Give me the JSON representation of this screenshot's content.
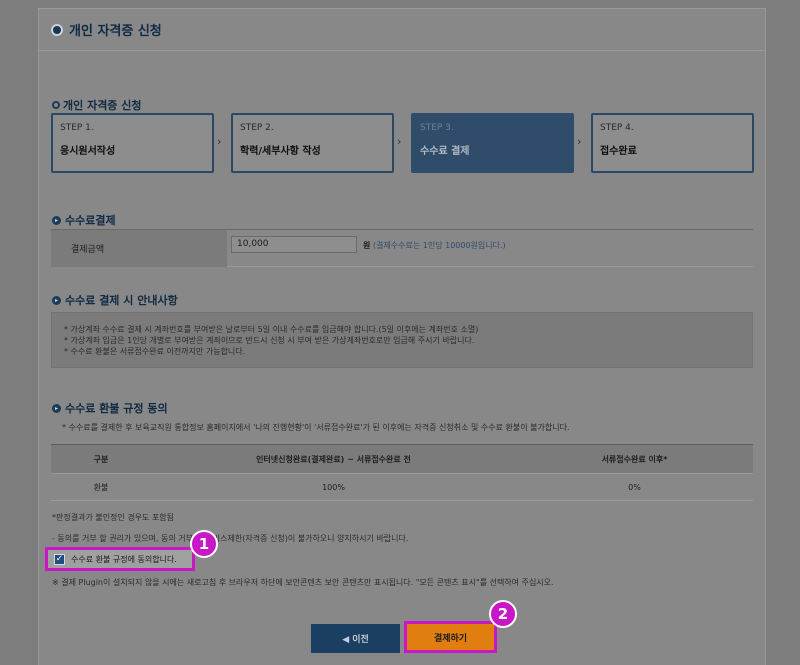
{
  "header": {
    "title": "개인 자격증 신청"
  },
  "section_title": "개인 자격증 신청",
  "steps": [
    {
      "num": "STEP 1.",
      "name": "응시원서작성"
    },
    {
      "num": "STEP 2.",
      "name": "학력/세부사항 작성"
    },
    {
      "num": "STEP 3.",
      "name": "수수료 결제"
    },
    {
      "num": "STEP 4.",
      "name": "접수완료"
    }
  ],
  "active_step": 3,
  "payment": {
    "title": "수수료결제",
    "label": "결제금액",
    "amount": "10,000",
    "unit": "원",
    "unit_note": "(결제수수료는 1인당 10000원입니다.)"
  },
  "notice": {
    "title": "수수료 결제 시 안내사항",
    "lines": [
      "* 가상계좌 수수료 결제 시 계좌번호를 부여받은 날로부터 5일 이내 수수료를 입금해야 합니다.(5일 이후에는 계좌번호 소멸)",
      "* 가상계좌 입금은 1인당 개별로 부여받은 계좌이므로 반드시 신청 시 부여 받은 가상계좌번호로만 입금해 주시기 바랍니다.",
      "* 수수료 환불은 서류접수완료 이전까지만 가능합니다."
    ]
  },
  "refund": {
    "title": "수수료 환불 규정 동의",
    "desc": "* 수수료를 결제한 후 보육교직원 통합정보 홈페이지에서 '나의 진행현황'이 '서류접수완료'가 된 이후에는 자격증 신청취소 및 수수료 환불이 불가합니다.",
    "table": {
      "headers": [
        "구분",
        "인터넷신청완료(결제완료) ~ 서류접수완료 전",
        "서류접수완료 이후*"
      ],
      "rows": [
        [
          "환불",
          "100%",
          "0%"
        ]
      ]
    }
  },
  "notes": {
    "review": "*판정결과가 불인정인 경우도 포함됨",
    "consent": "- 동의를 거부 할 권리가 있으며, 동의 거부 시 서비스제한(자격증 신청)이 불가하오니 양지하시기 바랍니다.",
    "plugin": "※ 결제 Plugin이 설치되지 않을 시에는 새로고침 후 브라우저 하단에 보안콘텐츠 보안 콘텐츠만 표시됩니다. \"모든 콘텐츠 표시\"를 선택하여 주십시오."
  },
  "agree": {
    "label": "수수료 환불 규정에 동의합니다.",
    "checked": true
  },
  "buttons": {
    "prev": "◀ 이전",
    "pay": "결제하기"
  },
  "badges": [
    "1",
    "2"
  ],
  "colors": {
    "highlight": "#c717c7",
    "pay_button": "#e07f10",
    "nav_blue": "#1b3f63"
  }
}
